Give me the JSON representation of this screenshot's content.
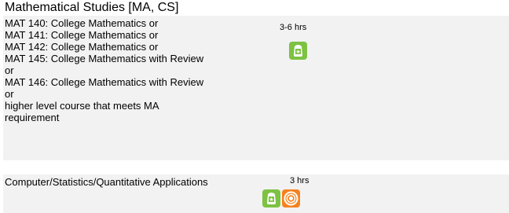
{
  "section": {
    "title": "Mathematical Studies [MA, CS]"
  },
  "rows": [
    {
      "lines": [
        "MAT 140: College Mathematics or",
        "MAT 141: College Mathematics or",
        "MAT 142: College Mathematics or",
        "MAT 145: College Mathematics with Review",
        "or",
        "MAT 146: College Mathematics with Review",
        "or",
        "higher level course that meets MA",
        "requirement"
      ],
      "hours": "3-6 hrs",
      "icons": [
        "online-course-icon"
      ]
    },
    {
      "lines": [
        "Computer/Statistics/Quantitative Applications"
      ],
      "hours": "3 hrs",
      "icons": [
        "online-course-icon",
        "hybrid-course-icon"
      ]
    }
  ],
  "colors": {
    "row_background": "#f2f2f2",
    "green_icon": "#7dc242",
    "orange_icon": "#f58220"
  }
}
